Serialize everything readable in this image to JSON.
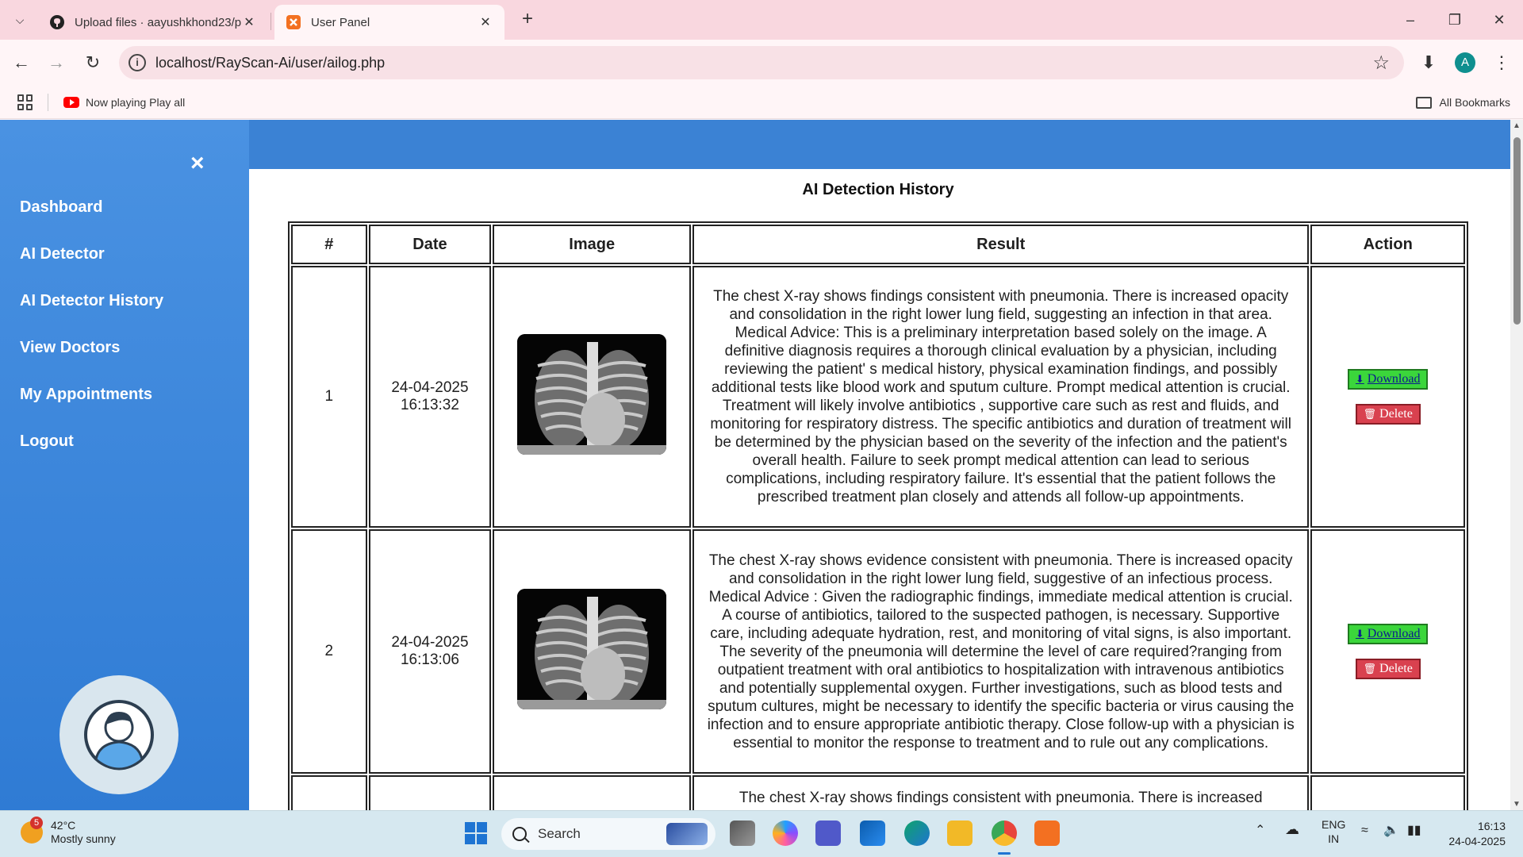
{
  "browser": {
    "tabs": [
      {
        "title": "Upload files · aayushkhond23/p",
        "active": false,
        "icon": "github-icon"
      },
      {
        "title": "User Panel",
        "active": true,
        "icon": "xampp-icon"
      }
    ],
    "url": "localhost/RayScan-Ai/user/ailog.php",
    "profile_initial": "A",
    "bookmarks": [
      {
        "label": "Now playing Play all",
        "icon": "youtube-icon"
      }
    ],
    "all_bookmarks_label": "All Bookmarks"
  },
  "sidebar": {
    "close_symbol": "×",
    "items": [
      {
        "label": "Dashboard"
      },
      {
        "label": "AI Detector"
      },
      {
        "label": "AI Detector History"
      },
      {
        "label": "View Doctors"
      },
      {
        "label": "My Appointments"
      },
      {
        "label": "Logout"
      }
    ]
  },
  "main": {
    "title": "AI Detection History",
    "columns": [
      "#",
      "Date",
      "Image",
      "Result",
      "Action"
    ],
    "download_label": "Download",
    "delete_label": "Delete",
    "rows": [
      {
        "index": "1",
        "date": "24-04-2025",
        "time": "16:13:32",
        "result": "The chest X-ray shows findings consistent with pneumonia. There is increased opacity and consolidation in the right lower lung field, suggesting an infection in that area. Medical Advice: This is a preliminary interpretation based solely on the image. A definitive diagnosis requires a thorough clinical evaluation by a physician, including reviewing the patient' s medical history, physical examination findings, and possibly additional tests like blood work and sputum culture. Prompt medical attention is crucial. Treatment will likely involve antibiotics , supportive care such as rest and fluids, and monitoring for respiratory distress. The specific antibiotics and duration of treatment will be determined by the physician based on the severity of the infection and the patient's overall health. Failure to seek prompt medical attention can lead to serious complications, including respiratory failure. It's essential that the patient follows the prescribed treatment plan closely and attends all follow-up appointments."
      },
      {
        "index": "2",
        "date": "24-04-2025",
        "time": "16:13:06",
        "result": "The chest X-ray shows evidence consistent with pneumonia. There is increased opacity and consolidation in the right lower lung field, suggestive of an infectious process. Medical Advice : Given the radiographic findings, immediate medical attention is crucial. A course of antibiotics, tailored to the suspected pathogen, is necessary. Supportive care, including adequate hydration, rest, and monitoring of vital signs, is also important. The severity of the pneumonia will determine the level of care required?ranging from outpatient treatment with oral antibiotics to hospitalization with intravenous antibiotics and potentially supplemental oxygen. Further investigations, such as blood tests and sputum cultures, might be necessary to identify the specific bacteria or virus causing the infection and to ensure appropriate antibiotic therapy. Close follow-up with a physician is essential to monitor the response to treatment and to rule out any complications."
      },
      {
        "index": "",
        "date": "",
        "time": "",
        "result": "The chest X-ray shows findings consistent with pneumonia. There is increased"
      }
    ]
  },
  "taskbar": {
    "weather_temp": "42°C",
    "weather_desc": "Mostly sunny",
    "weather_badge": "5",
    "search_placeholder": "Search",
    "lang_top": "ENG",
    "lang_bottom": "IN",
    "time": "16:13",
    "date": "24-04-2025"
  }
}
